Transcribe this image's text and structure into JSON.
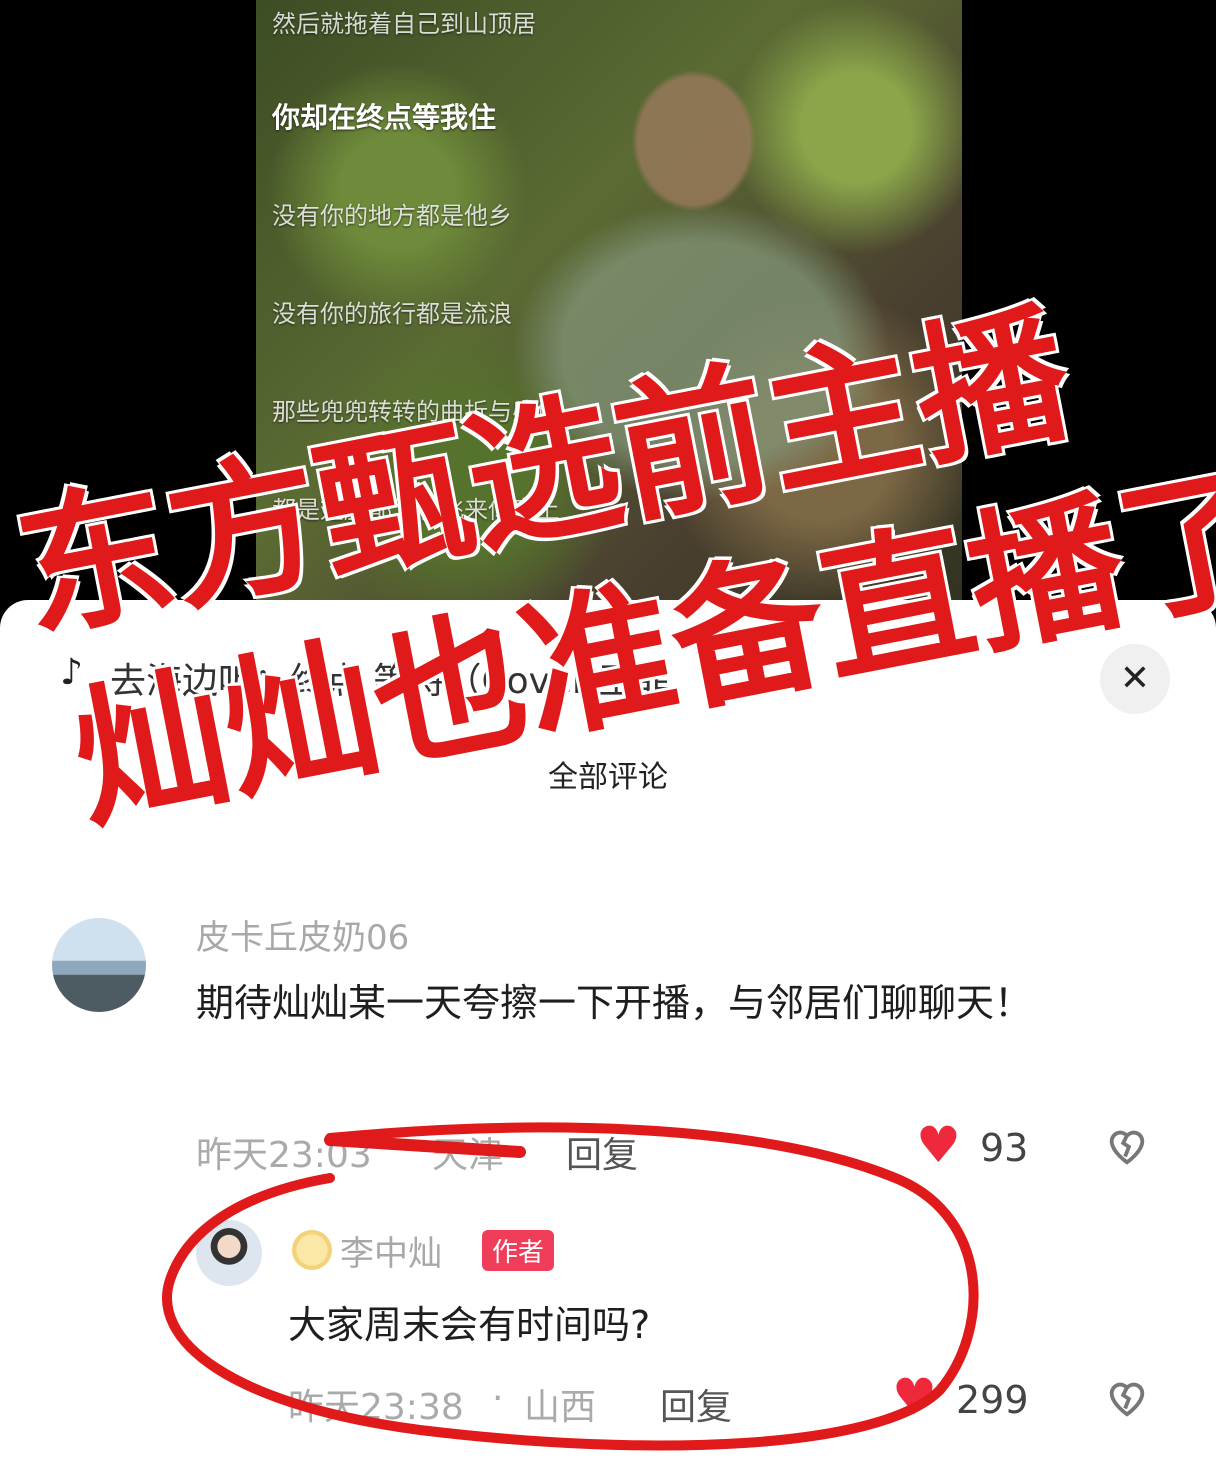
{
  "player": {
    "lyrics": [
      "然后就拖着自己到山顶居",
      "你却在终点等我住",
      "没有你的地方都是他乡",
      "没有你的旅行都是流浪",
      "那些兜兜转转的曲折与感伤",
      "都是翅膀都为了飞来你肩上"
    ],
    "current_lyric_index": 1
  },
  "sheet": {
    "song_title": "去海边听：终点 等待（Cover 王菲",
    "section_title": "全部评论",
    "close_icon": "close-icon",
    "note_icon": "music-note-icon"
  },
  "comments": [
    {
      "username": "皮卡丘皮奶06",
      "text": "期待灿灿某一天夸擦一下开播，与邻居们聊聊天！",
      "time": "昨天23:03",
      "location": "天津",
      "reply_label": "回复",
      "likes": "93"
    },
    {
      "username": "李中灿",
      "badge": "作者",
      "text": "大家周末会有时间吗?",
      "time": "昨天23:38",
      "location": "山西",
      "reply_label": "回复",
      "likes": "299"
    }
  ],
  "overlay": {
    "line1": "东方甄选前主播",
    "line2": "灿灿也准备直播了",
    "color": "#e01a1a"
  },
  "colors": {
    "like": "#f0283c",
    "badge": "#ef3d5a"
  }
}
